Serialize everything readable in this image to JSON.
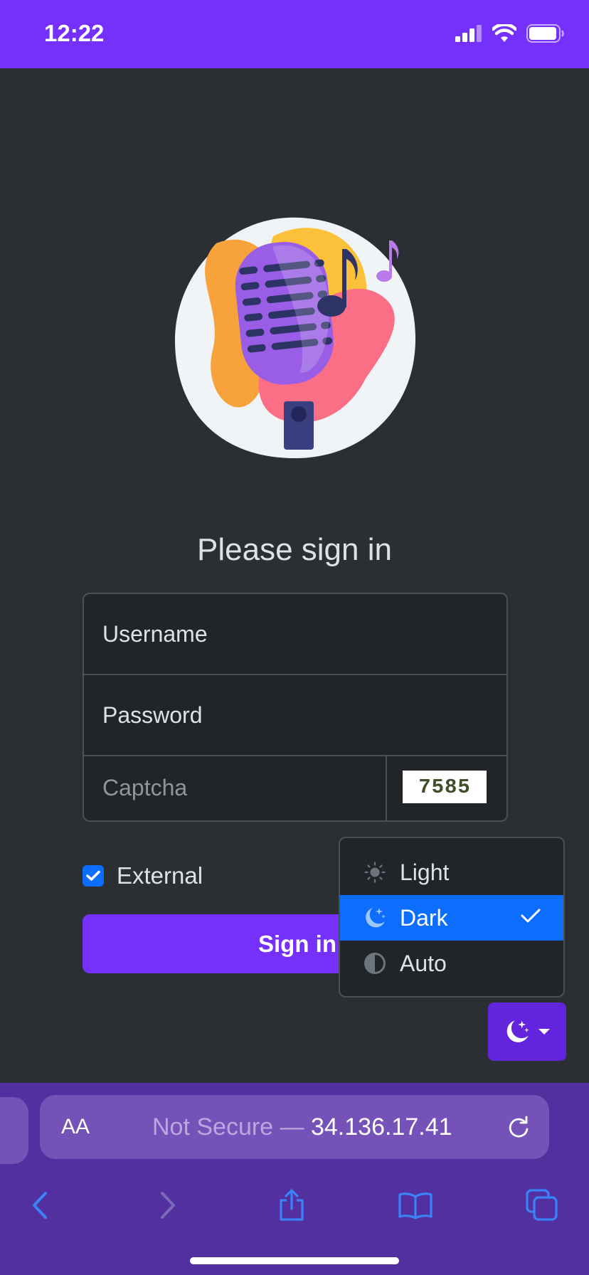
{
  "status": {
    "time": "12:22"
  },
  "login": {
    "title": "Please sign in",
    "username_placeholder": "Username",
    "password_placeholder": "Password",
    "captcha_placeholder": "Captcha",
    "captcha_code": "7585",
    "external_label": "External",
    "external_checked": true,
    "signin_label": "Sign in"
  },
  "theme_menu": {
    "items": [
      {
        "label": "Light",
        "icon": "sun-icon",
        "active": false
      },
      {
        "label": "Dark",
        "icon": "moon-stars-icon",
        "active": true
      },
      {
        "label": "Auto",
        "icon": "circle-half-icon",
        "active": false
      }
    ]
  },
  "browser": {
    "aa_label": "AA",
    "url_prefix": "Not Secure — ",
    "url_host": "34.136.17.41"
  },
  "colors": {
    "accent": "#7530fb",
    "selected": "#0d6efd",
    "background": "#2b2f33"
  }
}
